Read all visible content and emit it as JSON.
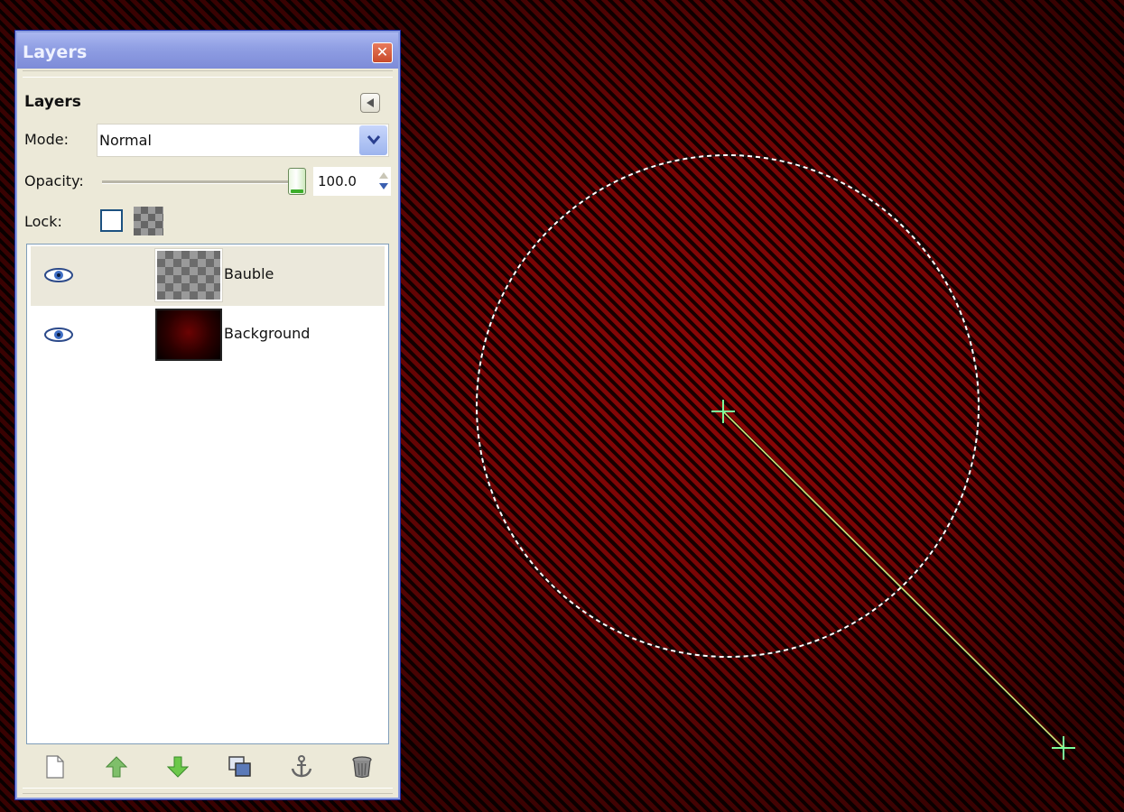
{
  "window": {
    "title": "Layers",
    "close_label": "✕"
  },
  "panel": {
    "header": "Layers"
  },
  "mode": {
    "label": "Mode:",
    "value": "Normal"
  },
  "opacity": {
    "label": "Opacity:",
    "value": "100.0",
    "level": 1.0
  },
  "lock": {
    "label": "Lock:",
    "pixels_locked": false
  },
  "layers": [
    {
      "name": "Bauble",
      "visible": true,
      "selected": true,
      "thumb": "transparent"
    },
    {
      "name": "Background",
      "visible": true,
      "selected": false,
      "thumb": "dark-red"
    }
  ],
  "bottom_buttons": [
    {
      "name": "new-layer-button",
      "icon": "new-layer-icon"
    },
    {
      "name": "raise-layer-button",
      "icon": "raise-arrow-icon"
    },
    {
      "name": "lower-layer-button",
      "icon": "lower-arrow-icon"
    },
    {
      "name": "duplicate-layer-button",
      "icon": "duplicate-icon"
    },
    {
      "name": "anchor-layer-button",
      "icon": "anchor-icon"
    },
    {
      "name": "delete-layer-button",
      "icon": "trash-icon"
    }
  ],
  "colors": {
    "canvas_stripe_light": "#8e0606",
    "canvas_stripe_dark": "#1a0000",
    "selection_outline": "#ffffff",
    "guide_line": "#c8e87a",
    "crosshair": "#7cff9a",
    "dialog_bg": "#ece9d8",
    "titlebar": "#8f9ee3"
  }
}
